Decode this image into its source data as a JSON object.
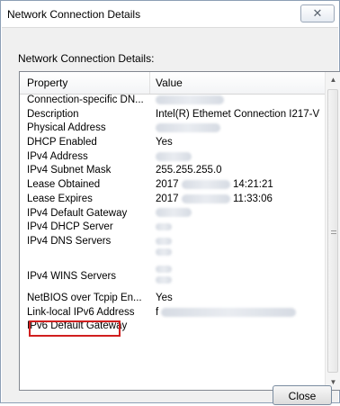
{
  "window": {
    "title": "Network Connection Details"
  },
  "dialog": {
    "group_label": "Network Connection Details:"
  },
  "columns": {
    "property": "Property",
    "value": "Value"
  },
  "rows": [
    {
      "property": "Connection-specific DN...",
      "value": "",
      "blur_value": true
    },
    {
      "property": "Description",
      "value": "Intel(R) Ethemet Connection I217-V"
    },
    {
      "property": "Physical Address",
      "value": "",
      "blur_value": true
    },
    {
      "property": "DHCP Enabled",
      "value": "Yes"
    },
    {
      "property": "IPv4 Address",
      "value": "",
      "blur_value": true
    },
    {
      "property": "IPv4 Subnet Mask",
      "value": "255.255.255.0"
    },
    {
      "property": "Lease Obtained",
      "value_prefix": "2017",
      "value_suffix": "14:21:21",
      "blur_value": true
    },
    {
      "property": "Lease Expires",
      "value_prefix": "2017",
      "value_suffix": "11:33:06",
      "blur_value": true
    },
    {
      "property": "IPv4 Default Gateway",
      "value": "",
      "blur_value": true
    },
    {
      "property": "IPv4 DHCP Server",
      "value": "",
      "blur_value": true
    },
    {
      "property": "IPv4 DNS Servers",
      "value": "",
      "blur_value": true,
      "highlighted": true
    },
    {
      "property": "IPv4 WINS Servers",
      "value": "",
      "blur_value": true
    },
    {
      "property": "NetBIOS over Tcpip En...",
      "value": "Yes"
    },
    {
      "property": "Link-local IPv6 Address",
      "value_prefix": "f",
      "blur_value": true
    },
    {
      "property": "IPv6 Default Gateway",
      "value": ""
    }
  ],
  "buttons": {
    "close": "Close"
  },
  "colors": {
    "highlight_border": "#d11f1f",
    "window_border": "#8c9fb5"
  }
}
